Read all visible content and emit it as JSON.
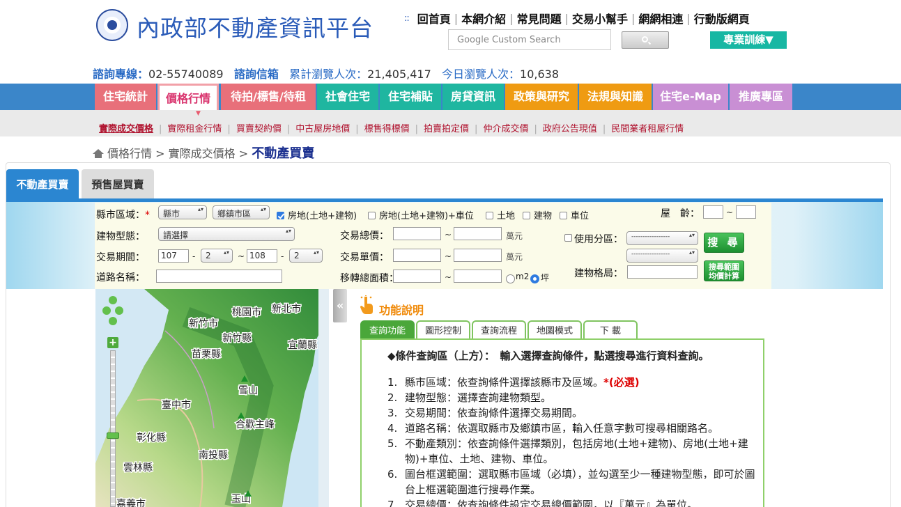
{
  "header": {
    "site_title": "內政部不動產資訊平台",
    "top_nav": [
      "回首頁",
      "本網介紹",
      "常見問題",
      "交易小幫手",
      "網網相連",
      "行動版網頁"
    ],
    "search_placeholder": "Google Custom Search",
    "training_button": "專業訓練▼"
  },
  "infobar": {
    "hotline_label": "諮詢專線：",
    "hotline_value": "02-55740089",
    "mailbox_label": "諮詢信箱",
    "total_label": "累計瀏覽人次：",
    "total_value": "21,405,417",
    "today_label": "今日瀏覽人次：",
    "today_value": "10,638"
  },
  "main_nav": {
    "items": [
      {
        "label": "住宅統計",
        "color": "#e8707a"
      },
      {
        "label": "價格行情",
        "color": "#ffffff"
      },
      {
        "label": "待拍/標售/待租",
        "color": "#e8707a"
      },
      {
        "label": "社會住宅",
        "color": "#1fb6a0"
      },
      {
        "label": "住宅補貼",
        "color": "#1fb6a0"
      },
      {
        "label": "房貸資訊",
        "color": "#1fb6a0"
      },
      {
        "label": "政策與研究",
        "color": "#ef9b12"
      },
      {
        "label": "法規與知識",
        "color": "#ef9b12"
      },
      {
        "label": "住宅e-Map",
        "color": "#c98fd4"
      },
      {
        "label": "推廣專區",
        "color": "#c98fd4"
      }
    ],
    "active_index": 1
  },
  "sub_nav": [
    "實際成交價格",
    "實際租金行情",
    "買賣契約價",
    "中古屋房地價",
    "標售得標價",
    "拍賣拍定價",
    "仲介成交價",
    "政府公告現值",
    "民間業者租屋行情"
  ],
  "breadcrumb": {
    "level1": "價格行情",
    "level2": "實際成交價格",
    "current": "不動產買賣",
    "sep": ">"
  },
  "tabs": {
    "realestate": "不動產買賣",
    "presale": "預售屋買賣"
  },
  "form": {
    "county_label": "縣市區域：",
    "required_mark": "*",
    "county_select": "縣市",
    "town_select": "鄉鎮市區",
    "types": [
      {
        "label": "房地(土地+建物)",
        "checked": true
      },
      {
        "label": "房地(土地+建物)+車位",
        "checked": false
      },
      {
        "label": "土地",
        "checked": false
      },
      {
        "label": "建物",
        "checked": false
      },
      {
        "label": "車位",
        "checked": false
      }
    ],
    "house_age_label": "屋　齡：",
    "building_type_label": "建物型態：",
    "building_type_select": "請選擇",
    "total_price_label": "交易總價：",
    "unit_wan": "萬元",
    "zoning_label": "使用分區：",
    "zoning_select_1": "-----------------",
    "zoning_select_2": "-----------------",
    "period_label": "交易期間：",
    "period_from_year": "107",
    "period_from_month": "2",
    "period_to_year": "108",
    "period_to_month": "2",
    "unit_price_label": "交易單價：",
    "road_label": "道路名稱：",
    "area_label": "移轉總面積：",
    "area_units": [
      "m2",
      "坪"
    ],
    "area_unit_selected": "坪",
    "layout_label": "建物格局：",
    "tilde": "~",
    "dash": "-",
    "search_button": "搜 尋",
    "range_button_line1": "搜尋範圍",
    "range_button_line2": "均價計算"
  },
  "map": {
    "labels": [
      "桃園市",
      "新北市",
      "新竹市",
      "新竹縣",
      "宜蘭縣",
      "苗栗縣",
      "雪山",
      "臺中市",
      "合歡主峰",
      "彰化縣",
      "南投縣",
      "雲林縣",
      "玉山",
      "嘉義市"
    ],
    "toggle": "«"
  },
  "help": {
    "title": "功能說明",
    "tabs": [
      "查詢功能",
      "圖形控制",
      "查詢流程",
      "地圖模式",
      "下 載"
    ],
    "heading": "◆條件查詢區（上方）：　輸入選擇查詢條件，點選搜尋進行資料查詢。",
    "items": [
      {
        "num": "1.",
        "text": "縣市區域：依查詢條件選擇該縣市及區域。",
        "req": "*(必選)"
      },
      {
        "num": "2.",
        "text": "建物型態：選擇查詢建物類型。",
        "req": ""
      },
      {
        "num": "3.",
        "text": "交易期間：依查詢條件選擇交易期間。",
        "req": ""
      },
      {
        "num": "4.",
        "text": "道路名稱：依選取縣市及鄉鎮市區，輸入任意字數可搜尋相關路名。",
        "req": ""
      },
      {
        "num": "5.",
        "text": "不動產類別：依查詢條件選擇類別，包括房地(土地+建物)、房地(土地+建物)+車位、土地、建物、車位。",
        "req": ""
      },
      {
        "num": "6.",
        "text": "圖台框選範圍：選取縣市區域（必填），並勾選至少一種建物型態，即可於圖台上框選範圍進行搜尋作業。",
        "req": ""
      },
      {
        "num": "7.",
        "text": "交易總價：依查詢條件設定交易總價範圍，以『萬元』為單位。",
        "req": ""
      }
    ]
  }
}
